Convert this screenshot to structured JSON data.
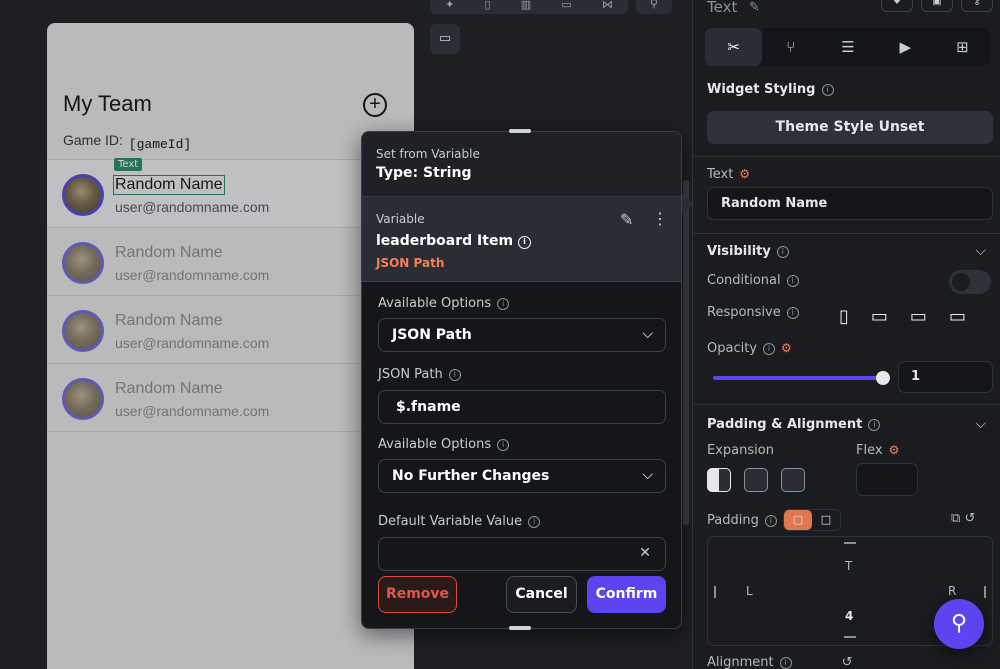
{
  "canvas": {
    "phone": {
      "title": "My Team",
      "game_id_label": "Game ID:",
      "game_id_value": "[gameId]",
      "selected_tag": "Text",
      "rows": [
        {
          "name": "Random Name",
          "email": "user@randomname.com"
        },
        {
          "name": "Random Name",
          "email": "user@randomname.com"
        },
        {
          "name": "Random Name",
          "email": "user@randomname.com"
        },
        {
          "name": "Random Name",
          "email": "user@randomname.com"
        }
      ]
    }
  },
  "popup": {
    "header_label": "Set from Variable",
    "header_type": "Type: String",
    "variable_label": "Variable",
    "variable_name": "leaderboard Item",
    "variable_sub": "JSON Path",
    "available_options_1_label": "Available Options",
    "available_options_1_value": "JSON Path",
    "json_path_label": "JSON Path",
    "json_path_value": "$.fname",
    "available_options_2_label": "Available Options",
    "available_options_2_value": "No Further Changes",
    "default_value_label": "Default Variable Value",
    "default_value": "",
    "remove_label": "Remove",
    "cancel_label": "Cancel",
    "confirm_label": "Confirm"
  },
  "panel": {
    "header": "Text",
    "widget_styling": "Widget Styling",
    "theme_style": "Theme Style Unset",
    "text_label": "Text",
    "text_value": "Random Name",
    "visibility": "Visibility",
    "conditional": "Conditional",
    "responsive": "Responsive",
    "opacity": "Opacity",
    "opacity_value": "1",
    "padding_alignment": "Padding & Alignment",
    "expansion": "Expansion",
    "flex": "Flex",
    "padding": "Padding",
    "pad_t": "T",
    "pad_l": "L",
    "pad_r": "R",
    "pad_bottom_value": "4",
    "alignment": "Alignment"
  },
  "colors": {
    "accent": "#5b45f0",
    "variable_orange": "#f2815b",
    "remove_red": "#e0584a",
    "selection_green": "#2f8a6e"
  }
}
